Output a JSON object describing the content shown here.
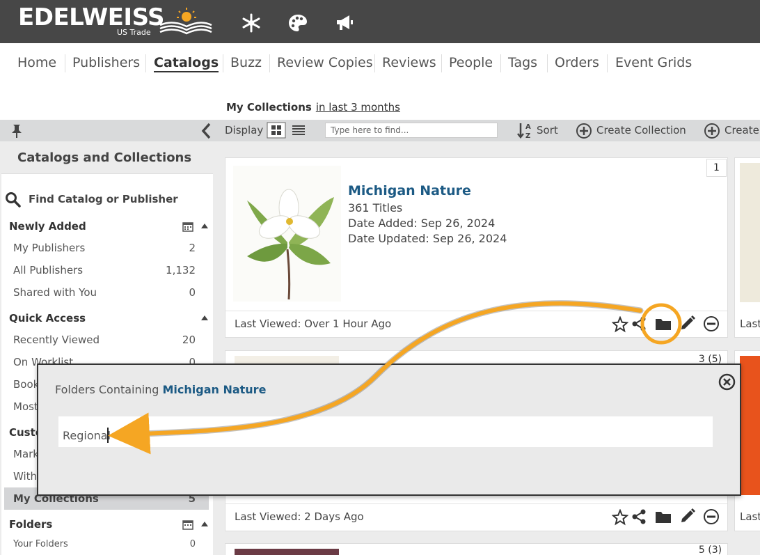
{
  "brand": {
    "name": "EDELWEISS",
    "sub": "US Trade"
  },
  "nav": {
    "items": [
      "Home",
      "Publishers",
      "Catalogs",
      "Buzz",
      "Review Copies",
      "Reviews",
      "People",
      "Tags",
      "Orders",
      "Event Grids"
    ],
    "active": "Catalogs"
  },
  "collections_header": {
    "title": "My Collections",
    "range_link": "in last 3 months"
  },
  "toolbar": {
    "display_label": "Display",
    "search_placeholder": "Type here to find...",
    "sort_label": "Sort",
    "create_collection_label": "Create Collection",
    "create_label": "Create"
  },
  "sidebar": {
    "heading": "Catalogs and Collections",
    "find_label": "Find Catalog or Publisher",
    "sections": {
      "newly_added": {
        "title": "Newly Added",
        "items": [
          {
            "label": "My Publishers",
            "count": "2"
          },
          {
            "label": "All Publishers",
            "count": "1,132"
          },
          {
            "label": "Shared with You",
            "count": "0"
          }
        ]
      },
      "quick_access": {
        "title": "Quick Access",
        "items": [
          {
            "label": "Recently Viewed",
            "count": "20"
          },
          {
            "label": "On Worklist",
            "count": "0"
          },
          {
            "label": "Book",
            "count": ""
          },
          {
            "label": "Most",
            "count": ""
          }
        ]
      },
      "custom": {
        "title": "Custo",
        "items": [
          {
            "label": "Mark",
            "count": ""
          },
          {
            "label": "With",
            "count": ""
          },
          {
            "label": "My Collections",
            "count": "5"
          }
        ]
      },
      "folders": {
        "title": "Folders",
        "items": [
          {
            "label": "Your Folders",
            "count": "0"
          }
        ]
      }
    }
  },
  "cards": [
    {
      "title": "Michigan Nature",
      "titles": "361 Titles",
      "date_added": "Date Added: Sep 26, 2024",
      "date_updated": "Date Updated: Sep 26, 2024",
      "last_viewed": "Last Viewed: Over 1 Hour Ago",
      "rank": "1"
    },
    {
      "rank": "3 (5)",
      "last_viewed": "Last Viewed: 2 Days Ago"
    },
    {
      "rank": "5 (3)"
    }
  ],
  "right_cards": [
    {
      "last_viewed": "Last"
    },
    {
      "last_viewed": "Last"
    }
  ],
  "popup": {
    "title_prefix": "Folders Containing",
    "collection_name": "Michigan Nature",
    "folder_value": "Regional"
  },
  "colors": {
    "accent": "#f5a623",
    "link": "#1c5a84",
    "topbar": "#474747",
    "toolbar": "#d9dadb"
  }
}
